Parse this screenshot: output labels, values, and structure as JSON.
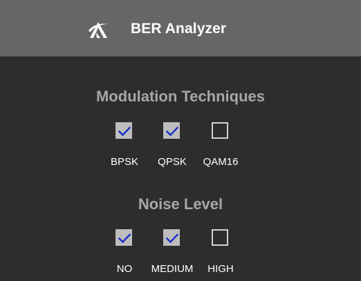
{
  "header": {
    "title": "BER Analyzer",
    "logo_icon": "stylized-a-logo"
  },
  "modulation": {
    "title": "Modulation Techniques",
    "options": [
      {
        "label": "BPSK",
        "checked": true
      },
      {
        "label": "QPSK",
        "checked": true
      },
      {
        "label": "QAM16",
        "checked": false
      }
    ]
  },
  "noise": {
    "title": "Noise Level",
    "options": [
      {
        "label": "NO",
        "checked": true
      },
      {
        "label": "MEDIUM",
        "checked": true
      },
      {
        "label": "HIGH",
        "checked": false
      }
    ]
  },
  "colors": {
    "header_bg": "#666666",
    "body_bg": "#2d2d2d",
    "section_title": "#a7a7a7",
    "checkmark": "#1a2fc8",
    "checkbox_checked_bg": "#bdbdbd"
  }
}
